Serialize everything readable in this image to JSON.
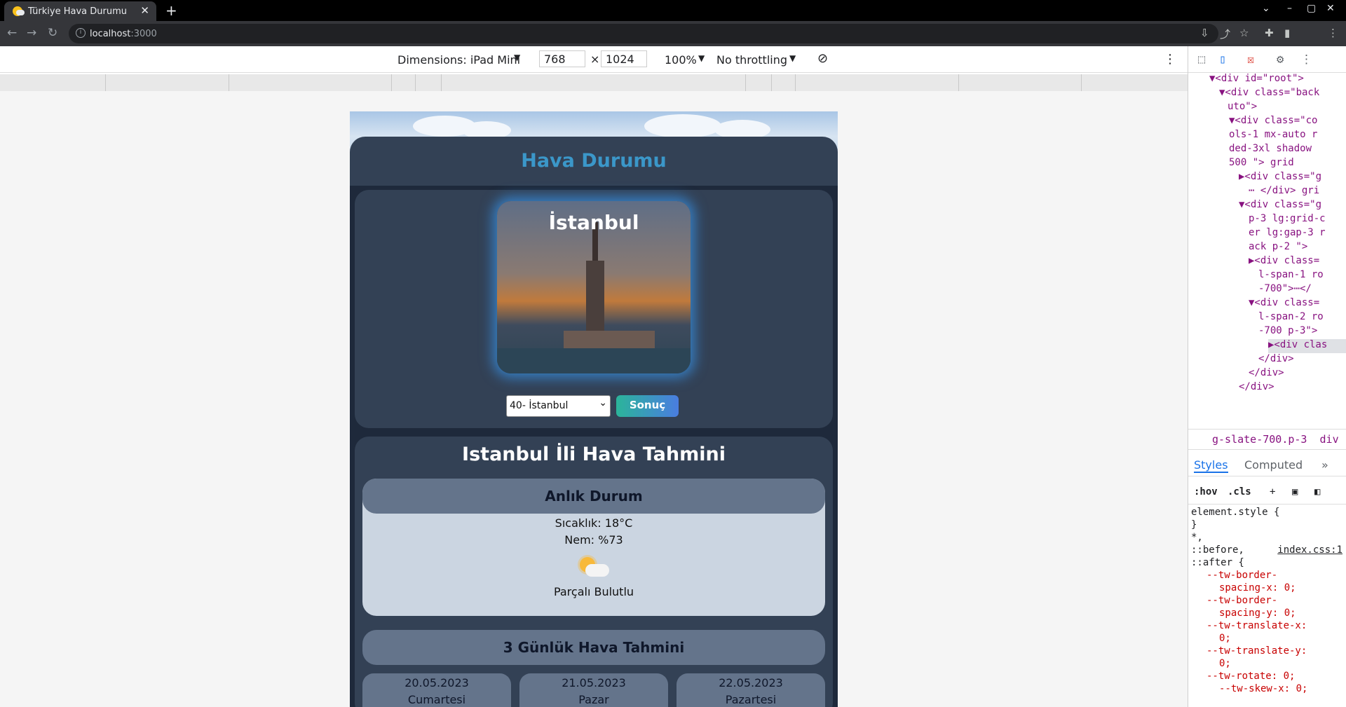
{
  "browser": {
    "tab_title": "Türkiye Hava Durumu",
    "url_host": "localhost",
    "url_port": ":3000"
  },
  "devbar": {
    "dimensions": "Dimensions: iPad Mini",
    "width": "768",
    "height": "1024",
    "zoom": "100%",
    "throttling": "No throttling"
  },
  "devtools": {
    "dom_lines": [
      "▼<div id=\"root\">",
      "▼<div class=\"back",
      "uto\">",
      "▼<div class=\"co",
      "ols-1 mx-auto r",
      "ded-3xl shadow",
      "500 \"> grid",
      "▶<div class=\"g",
      "⋯ </div> gri",
      "▼<div class=\"g",
      "p-3 lg:grid-c",
      "er lg:gap-3 r",
      "ack p-2 \">",
      "▶<div class=",
      "l-span-1 ro",
      "-700\">⋯</",
      "▼<div class=",
      "l-span-2 ro",
      "-700 p-3\">",
      "▶<div clas",
      "</div>",
      "</div>",
      "</div>"
    ],
    "breadcrumb": "g-slate-700.p-3",
    "breadcrumb2": "div",
    "tab_styles": "Styles",
    "tab_computed": "Computed",
    "filter_hov": ":hov",
    "filter_cls": ".cls",
    "styles_lines": [
      "element.style {",
      "}",
      "*,",
      "::before,",
      "::after {",
      "--tw-border-",
      "spacing-x: 0;",
      "--tw-border-",
      "spacing-y: 0;",
      "--tw-translate-x:",
      "0;",
      "--tw-translate-y:",
      "0;",
      "--tw-rotate: 0;",
      "--tw-skew-x: 0;"
    ],
    "styles_source": "index.css:1"
  },
  "app": {
    "header_title": "Hava Durumu",
    "city_name": "İstanbul",
    "select_value": "40- İstanbul",
    "button_label": "Sonuç",
    "forecast_title": "Istanbul İli Hava Tahmini",
    "current": {
      "title": "Anlık Durum",
      "temperature": "Sıcaklık: 18°C",
      "humidity": "Nem: %73",
      "condition": "Parçalı Bulutlu",
      "icon": "partly-cloudy-icon"
    },
    "three_day": {
      "title": "3 Günlük Hava Tahmini",
      "days": [
        {
          "date": "20.05.2023",
          "name": "Cumartesi"
        },
        {
          "date": "21.05.2023",
          "name": "Pazar"
        },
        {
          "date": "22.05.2023",
          "name": "Pazartesi"
        }
      ]
    }
  }
}
